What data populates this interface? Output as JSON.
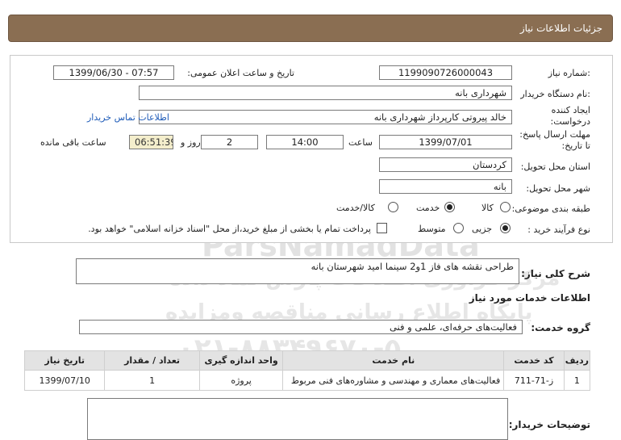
{
  "header": {
    "title": "جزئیات اطلاعات نیاز"
  },
  "form": {
    "need_number": {
      "label": "شماره نیاز:",
      "value": "1199090726000043"
    },
    "announce_datetime": {
      "label": "تاریخ و ساعت اعلان عمومی:",
      "value": "1399/06/30 - 07:57"
    },
    "buyer_org": {
      "label": "نام دستگاه خریدار:",
      "value": "شهرداری بانه"
    },
    "requester": {
      "label": "ایجاد کننده درخواست:",
      "value": "خالد پیروتی کارپرداز شهرداری بانه"
    },
    "buyer_contact_link": "اطلاعات تماس خریدار",
    "deadline": {
      "label": "مهلت ارسال پاسخ: تا تاریخ:",
      "date": "1399/07/01",
      "time_label": "ساعت",
      "time": "14:00",
      "days": "2",
      "days_label": "روز و",
      "remaining": "06:51:39",
      "remaining_label": "ساعت باقی مانده"
    },
    "province": {
      "label": "استان محل تحویل:",
      "value": "کردستان"
    },
    "city": {
      "label": "شهر محل تحویل:",
      "value": "بانه"
    },
    "category": {
      "label": "طبقه بندی موضوعی:",
      "options": [
        "کالا",
        "خدمت",
        "کالا/خدمت"
      ],
      "selected": "خدمت"
    },
    "purchase_type": {
      "label": "نوع فرآیند خرید :",
      "options": [
        "جزیی",
        "متوسط"
      ],
      "selected": "جزیی",
      "treasury_note": "پرداخت تمام یا بخشی از مبلغ خرید،از محل \"اسناد خزانه اسلامی\" خواهد بود."
    }
  },
  "description": {
    "label": "شرح کلی نیاز:",
    "value": "طراحی نقشه های فاز 1و2 سینما امید شهرستان بانه"
  },
  "services_info": {
    "title": "اطلاعات خدمات مورد نیاز"
  },
  "service_group": {
    "label": "گروه خدمت:",
    "value": "فعالیت‌های حرفه‌ای، علمی و فنی"
  },
  "table": {
    "columns": [
      "ردیف",
      "کد خدمت",
      "نام خدمت",
      "واحد اندازه گیری",
      "تعداد / مقدار",
      "تاریخ نیاز"
    ],
    "rows": [
      [
        "1",
        "ز-71-711",
        "فعالیت‌های معماری و مهندسی و مشاوره‌های فنی مربوط",
        "پروژه",
        "1",
        "1399/07/10"
      ]
    ]
  },
  "buyer_notes": {
    "label": "توضیحات خریدار:",
    "value": ""
  },
  "watermark": {
    "line1": "ParsNamadData",
    "line2": "مرکز فراوری اطلاعات پارس نماد داده",
    "line3": "پایگاه اطلاع رسانی مناقصه ومزایده",
    "line4": "۰۲۱-۸۸۳۴۹۶۷۰-۵",
    "top": "09101"
  }
}
